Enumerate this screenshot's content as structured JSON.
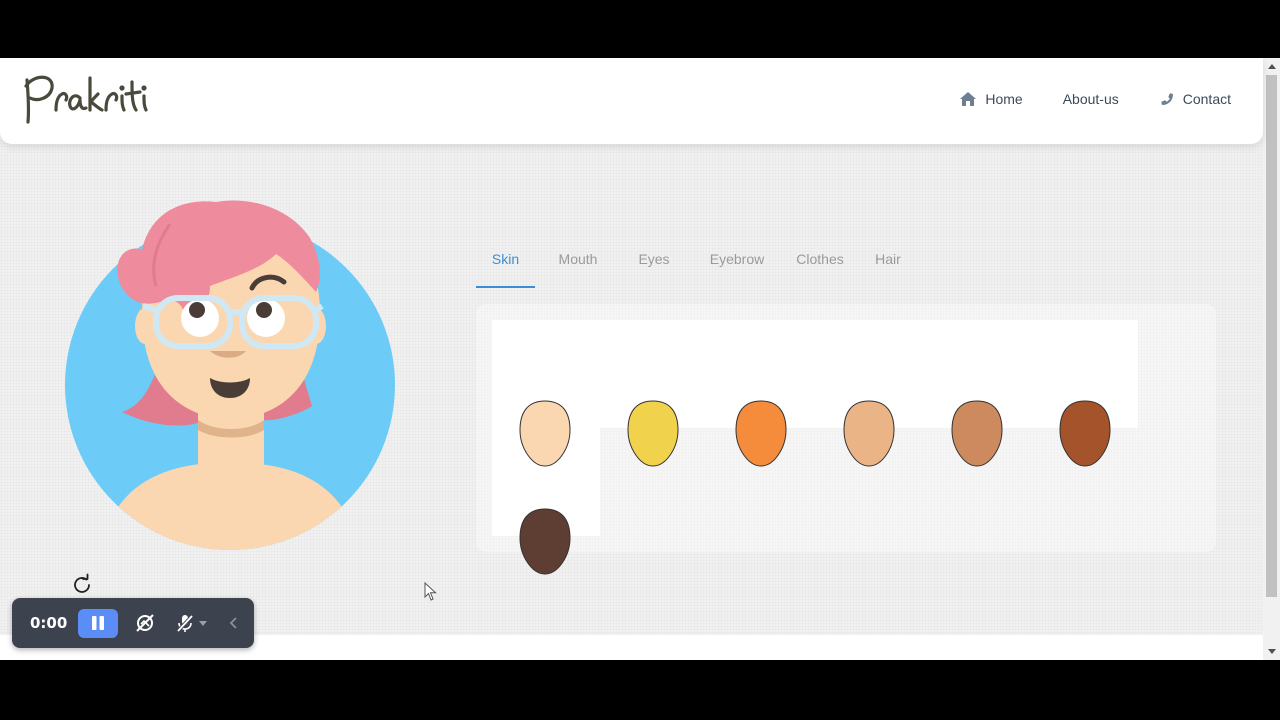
{
  "brand": {
    "name": "Prakriti"
  },
  "nav": {
    "items": [
      {
        "label": "Home",
        "icon": "home-icon"
      },
      {
        "label": "About-us",
        "icon": ""
      },
      {
        "label": "Contact",
        "icon": "phone-icon"
      }
    ]
  },
  "tabs": [
    {
      "label": "Skin",
      "active": true
    },
    {
      "label": "Mouth",
      "active": false
    },
    {
      "label": "Eyes",
      "active": false
    },
    {
      "label": "Eyebrow",
      "active": false
    },
    {
      "label": "Clothes",
      "active": false
    },
    {
      "label": "Hair",
      "active": false
    }
  ],
  "skin_options": [
    {
      "name": "skin-tone-light-peach",
      "color": "#fbd7b1"
    },
    {
      "name": "skin-tone-yellow",
      "color": "#f1d24c"
    },
    {
      "name": "skin-tone-orange",
      "color": "#f48c3b"
    },
    {
      "name": "skin-tone-tan",
      "color": "#eab486"
    },
    {
      "name": "skin-tone-caramel",
      "color": "#cd8a5e"
    },
    {
      "name": "skin-tone-brown",
      "color": "#a5532a"
    },
    {
      "name": "skin-tone-dark-brown",
      "color": "#5e3d32"
    }
  ],
  "avatar": {
    "background_color": "#6dcbf8",
    "skin_color": "#fbd7b1",
    "hair_color": "#ee8c9d",
    "glasses_color": "#cfe8f3"
  },
  "colors": {
    "accent": "#3b8ed6",
    "nav_text": "#3b4b5c",
    "recorder_bg": "#3d434e",
    "recorder_pause": "#5a8df5"
  },
  "recorder": {
    "time": "0:00"
  }
}
